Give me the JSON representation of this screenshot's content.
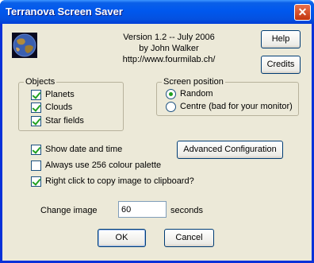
{
  "window": {
    "title": "Terranova Screen Saver",
    "close_glyph": "✕"
  },
  "about": {
    "version": "Version 1.2 -- July 2006",
    "author": "by John Walker",
    "url": "http://www.fourmilab.ch/"
  },
  "buttons": {
    "help": "Help",
    "credits": "Credits",
    "advanced": "Advanced Configuration",
    "ok": "OK",
    "cancel": "Cancel"
  },
  "objects": {
    "legend": "Objects",
    "items": [
      {
        "label": "Planets",
        "checked": true
      },
      {
        "label": "Clouds",
        "checked": true
      },
      {
        "label": "Star fields",
        "checked": true
      }
    ]
  },
  "screen_position": {
    "legend": "Screen position",
    "options": [
      {
        "label": "Random",
        "selected": true
      },
      {
        "label": "Centre (bad for your monitor)",
        "selected": false
      }
    ]
  },
  "options": [
    {
      "label": "Show date and time",
      "checked": true
    },
    {
      "label": "Always use 256 colour palette",
      "checked": false
    },
    {
      "label": "Right click to copy image to clipboard?",
      "checked": true
    }
  ],
  "change_image": {
    "label": "Change image",
    "value": "60",
    "unit": "seconds"
  },
  "colors": {
    "title_bar": "#0058ee",
    "dialog_bg": "#ece9d8",
    "check": "#21a121",
    "close": "#c2350e"
  },
  "icons": {
    "app": "planet-icon"
  }
}
